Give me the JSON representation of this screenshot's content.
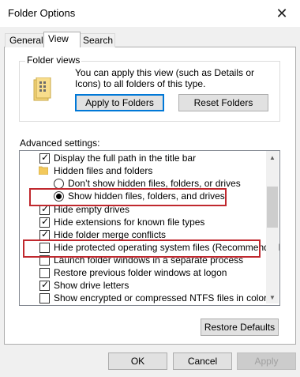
{
  "window": {
    "title": "Folder Options",
    "close_glyph": "✕"
  },
  "tabs": [
    {
      "label": "General",
      "active": false
    },
    {
      "label": "View",
      "active": true
    },
    {
      "label": "Search",
      "active": false
    }
  ],
  "folder_views": {
    "legend": "Folder views",
    "description": "You can apply this view (such as Details or Icons) to all folders of this type.",
    "icon": "folder-view-icon",
    "apply_button": "Apply to Folders",
    "reset_button": "Reset Folders"
  },
  "advanced": {
    "label": "Advanced settings:",
    "items": [
      {
        "type": "checkbox",
        "checked": true,
        "label": "Display the full path in the title bar",
        "indent": 1
      },
      {
        "type": "folder",
        "label": "Hidden files and folders",
        "indent": 1
      },
      {
        "type": "radio",
        "checked": false,
        "label": "Don’t show hidden files, folders, or drives",
        "indent": 2
      },
      {
        "type": "radio",
        "checked": true,
        "label": "Show hidden files, folders, and drives",
        "indent": 2
      },
      {
        "type": "checkbox",
        "checked": true,
        "label": "Hide empty drives",
        "indent": 1
      },
      {
        "type": "checkbox",
        "checked": true,
        "label": "Hide extensions for known file types",
        "indent": 1
      },
      {
        "type": "checkbox",
        "checked": true,
        "label": "Hide folder merge conflicts",
        "indent": 1
      },
      {
        "type": "checkbox",
        "checked": false,
        "label": "Hide protected operating system files (Recommended)",
        "indent": 1
      },
      {
        "type": "checkbox",
        "checked": false,
        "label": "Launch folder windows in a separate process",
        "indent": 1
      },
      {
        "type": "checkbox",
        "checked": false,
        "label": "Restore previous folder windows at logon",
        "indent": 1
      },
      {
        "type": "checkbox",
        "checked": true,
        "label": "Show drive letters",
        "indent": 1
      },
      {
        "type": "checkbox",
        "checked": false,
        "label": "Show encrypted or compressed NTFS files in color",
        "indent": 1
      }
    ],
    "restore_button": "Restore Defaults"
  },
  "footer": {
    "ok": "OK",
    "cancel": "Cancel",
    "apply": "Apply"
  },
  "colors": {
    "highlight": "#c0282e",
    "focus": "#0078d7"
  }
}
